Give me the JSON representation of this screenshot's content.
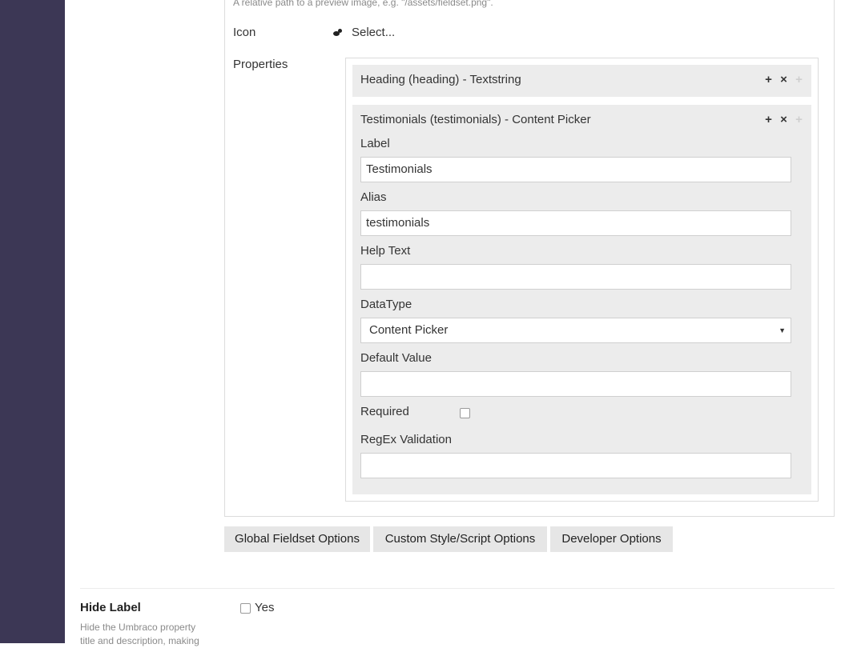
{
  "top_hint": "A relative path to a preview image, e.g. \"/assets/fieldset.png\".",
  "icon": {
    "label": "Icon",
    "select_text": "Select..."
  },
  "properties": {
    "label": "Properties",
    "items": [
      {
        "title": "Heading (heading) - Textstring"
      },
      {
        "title": "Testimonials (testimonials) - Content Picker",
        "label_caption": "Label",
        "label_value": "Testimonials",
        "alias_caption": "Alias",
        "alias_value": "testimonials",
        "help_caption": "Help Text",
        "help_value": "",
        "datatype_caption": "DataType",
        "datatype_value": "Content Picker",
        "default_caption": "Default Value",
        "default_value": "",
        "required_caption": "Required",
        "required_checked": false,
        "regex_caption": "RegEx Validation",
        "regex_value": ""
      }
    ],
    "actions": {
      "add": "+",
      "remove": "×",
      "move": "+"
    }
  },
  "tabs": [
    "Global Fieldset Options",
    "Custom Style/Script Options",
    "Developer Options"
  ],
  "hide_label": {
    "title": "Hide Label",
    "description": "Hide the Umbraco property title and description, making",
    "option": "Yes",
    "checked": false
  },
  "colors": {
    "sidebar": "#3c3755",
    "panel": "#ececec",
    "button": "#e6e6e6"
  }
}
